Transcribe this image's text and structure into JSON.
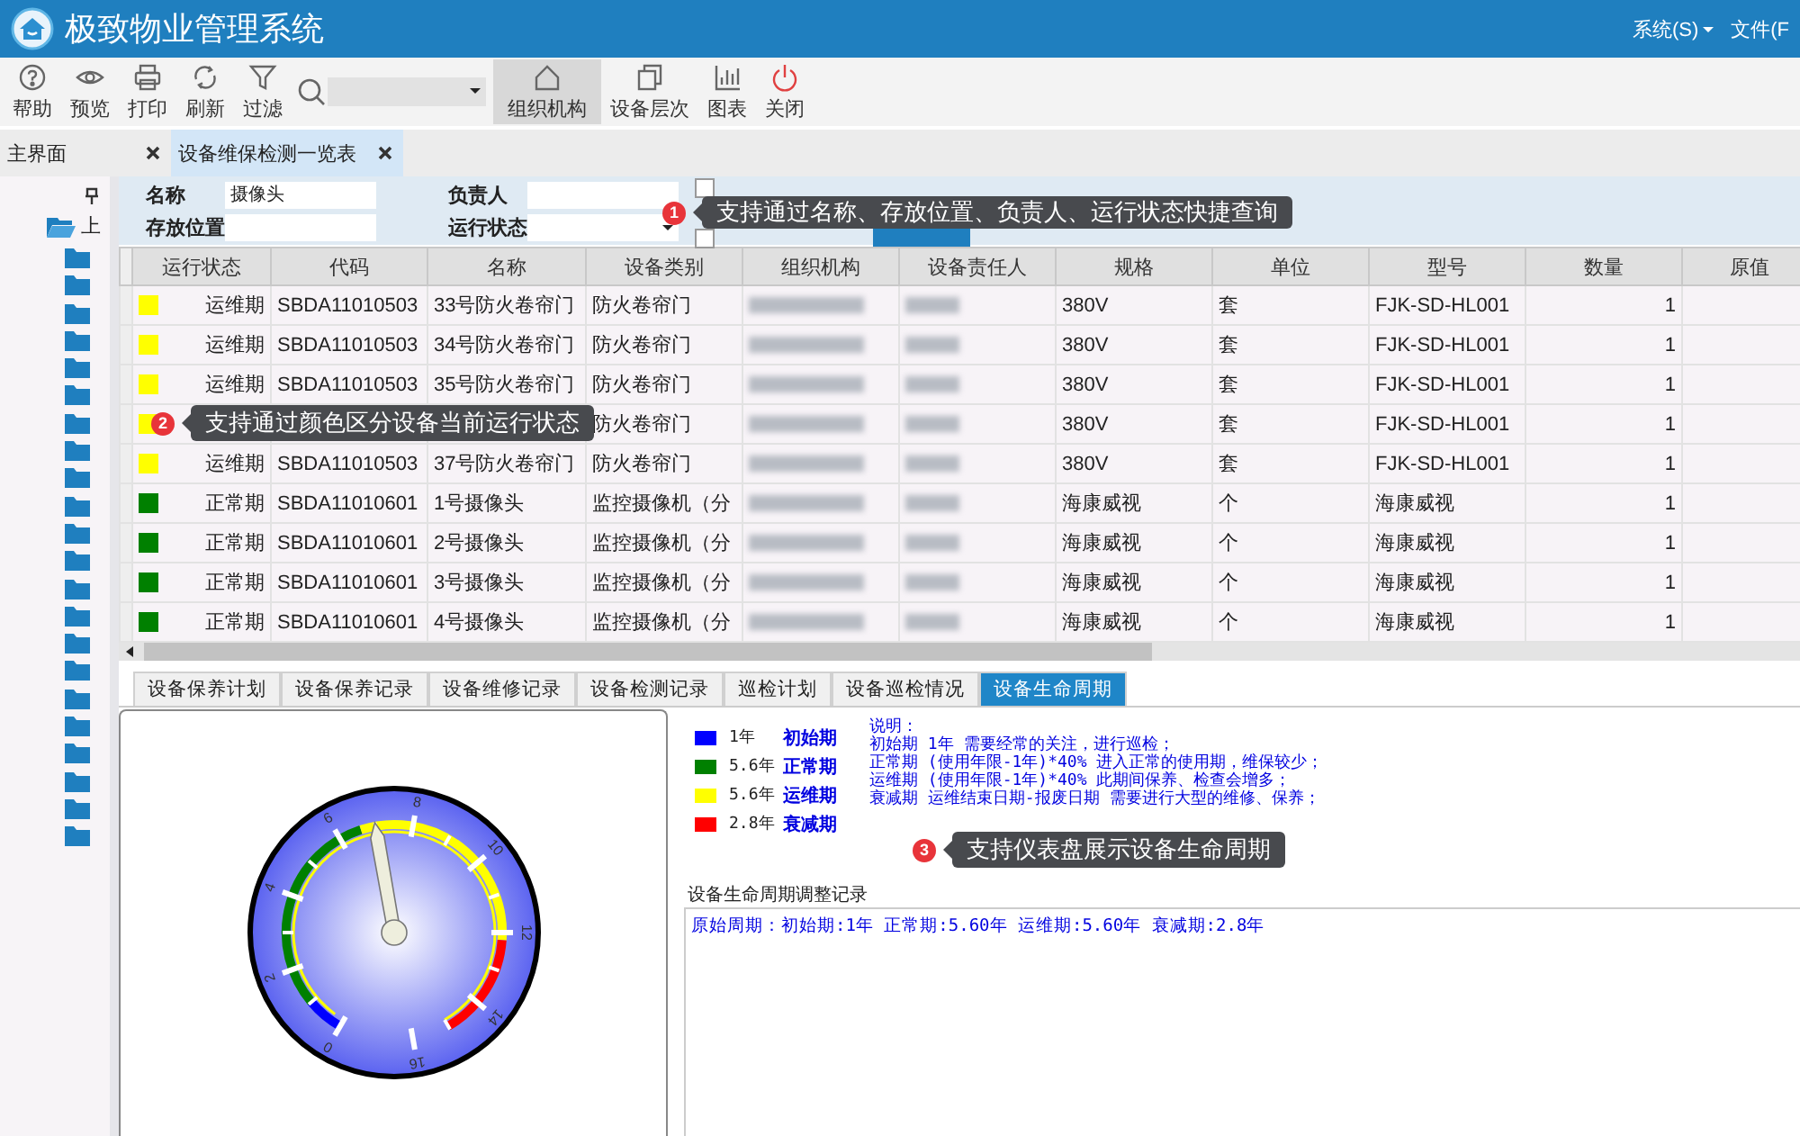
{
  "window": {
    "title": "极致物业管理系统"
  },
  "menu": [
    "系统(S)",
    "文件(F"
  ],
  "toolbar_left": [
    {
      "label": "帮助",
      "selected": false
    },
    {
      "label": "预览",
      "selected": false
    },
    {
      "label": "打印",
      "selected": false
    },
    {
      "label": "刷新",
      "selected": false
    },
    {
      "label": "过滤",
      "selected": false
    }
  ],
  "toolbar_right": [
    {
      "label": "组织机构",
      "selected": true
    },
    {
      "label": "设备层次",
      "selected": false
    },
    {
      "label": "图表",
      "selected": false
    },
    {
      "label": "关闭",
      "selected": false
    }
  ],
  "doc_tabs": [
    {
      "label": "主界面",
      "selected": false
    },
    {
      "label": "设备维保检测一览表",
      "selected": true
    }
  ],
  "sidebar": {
    "root": "上"
  },
  "filters": [
    {
      "label": "名称",
      "kind": "text",
      "value": "摄像头"
    },
    {
      "label": "负责人",
      "kind": "text"
    },
    {
      "label": "存放位置",
      "kind": "text"
    },
    {
      "label": "运行状态",
      "kind": "select"
    }
  ],
  "options": [
    {
      "checked": false
    },
    {
      "checked": false
    }
  ],
  "table": {
    "columns": [
      "运行状态",
      "代码",
      "名称",
      "设备类别",
      "组织机构",
      "设备责任人",
      "规格",
      "单位",
      "型号",
      "数量",
      "原值"
    ],
    "rows": [
      {
        "status": "运维期",
        "color": "#ffff00",
        "code": "SBDA11010503",
        "name": "33号防火卷帘门",
        "category": "防火卷帘门",
        "spec": "380V",
        "unit": "套",
        "model": "FJK-SD-HL001",
        "quantity": "1"
      },
      {
        "status": "运维期",
        "color": "#ffff00",
        "code": "SBDA11010503",
        "name": "34号防火卷帘门",
        "category": "防火卷帘门",
        "spec": "380V",
        "unit": "套",
        "model": "FJK-SD-HL001",
        "quantity": "1"
      },
      {
        "status": "运维期",
        "color": "#ffff00",
        "code": "SBDA11010503",
        "name": "35号防火卷帘门",
        "category": "防火卷帘门",
        "spec": "380V",
        "unit": "套",
        "model": "FJK-SD-HL001",
        "quantity": "1"
      },
      {
        "color": "#ffff00",
        "category": "防火卷帘门",
        "spec": "380V",
        "unit": "套",
        "model": "FJK-SD-HL001",
        "quantity": "1"
      },
      {
        "status": "运维期",
        "color": "#ffff00",
        "code": "SBDA11010503",
        "name": "37号防火卷帘门",
        "category": "防火卷帘门",
        "spec": "380V",
        "unit": "套",
        "model": "FJK-SD-HL001",
        "quantity": "1"
      },
      {
        "status": "正常期",
        "color": "#008000",
        "code": "SBDA11010601",
        "name": "1号摄像头",
        "category": "监控摄像机（分",
        "spec": "海康威视",
        "unit": "个",
        "model": "海康威视",
        "quantity": "1"
      },
      {
        "status": "正常期",
        "color": "#008000",
        "code": "SBDA11010601",
        "name": "2号摄像头",
        "category": "监控摄像机（分",
        "spec": "海康威视",
        "unit": "个",
        "model": "海康威视",
        "quantity": "1"
      },
      {
        "status": "正常期",
        "color": "#008000",
        "code": "SBDA11010601",
        "name": "3号摄像头",
        "category": "监控摄像机（分",
        "spec": "海康威视",
        "unit": "个",
        "model": "海康威视",
        "quantity": "1"
      },
      {
        "status": "正常期",
        "color": "#008000",
        "code": "SBDA11010601",
        "name": "4号摄像头",
        "category": "监控摄像机（分",
        "spec": "海康威视",
        "unit": "个",
        "model": "海康威视",
        "quantity": "1"
      }
    ]
  },
  "bottom_tabs": [
    {
      "label": "设备保养计划",
      "selected": false
    },
    {
      "label": "设备保养记录",
      "selected": false
    },
    {
      "label": "设备维修记录",
      "selected": false
    },
    {
      "label": "设备检测记录",
      "selected": false
    },
    {
      "label": "巡检计划",
      "selected": false
    },
    {
      "label": "设备巡检情况",
      "selected": false
    },
    {
      "label": "设备生命周期",
      "selected": true
    }
  ],
  "gauge": {
    "scale_labels": [
      "0",
      "2",
      "4",
      "6",
      "8",
      "10",
      "12",
      "14",
      "16"
    ],
    "level": 0.4375
  },
  "legend": [
    {
      "years": "1年",
      "phase": "初始期",
      "color": "#0000ff"
    },
    {
      "years": "5.6年",
      "phase": "正常期",
      "color": "#008000"
    },
    {
      "years": "5.6年",
      "phase": "运维期",
      "color": "#ffff00"
    },
    {
      "years": "2.8年",
      "phase": "衰减期",
      "color": "#ff0000"
    }
  ],
  "notes": {
    "title": "说明：",
    "lines": [
      "初始期 1年 需要经常的关注，进行巡检；",
      "正常期 (使用年限-1年)*40% 进入正常的使用期，维保较少；",
      "运维期 (使用年限-1年)*40% 此期间保养、检查会增多；",
      "衰减期 运维结束日期-报废日期 需要进行大型的维修、保养；"
    ]
  },
  "record": {
    "title": "设备生命周期调整记录",
    "text": "原始周期：初始期:1年 正常期:5.60年 运维期:5.60年 衰减期:2.8年"
  },
  "callouts": [
    {
      "number": "1",
      "text": "支持通过名称、存放位置、负责人、运行状态快捷查询"
    },
    {
      "number": "2",
      "text": "支持通过颜色区分设备当前运行状态"
    },
    {
      "number": "3",
      "text": "支持仪表盘展示设备生命周期"
    }
  ]
}
